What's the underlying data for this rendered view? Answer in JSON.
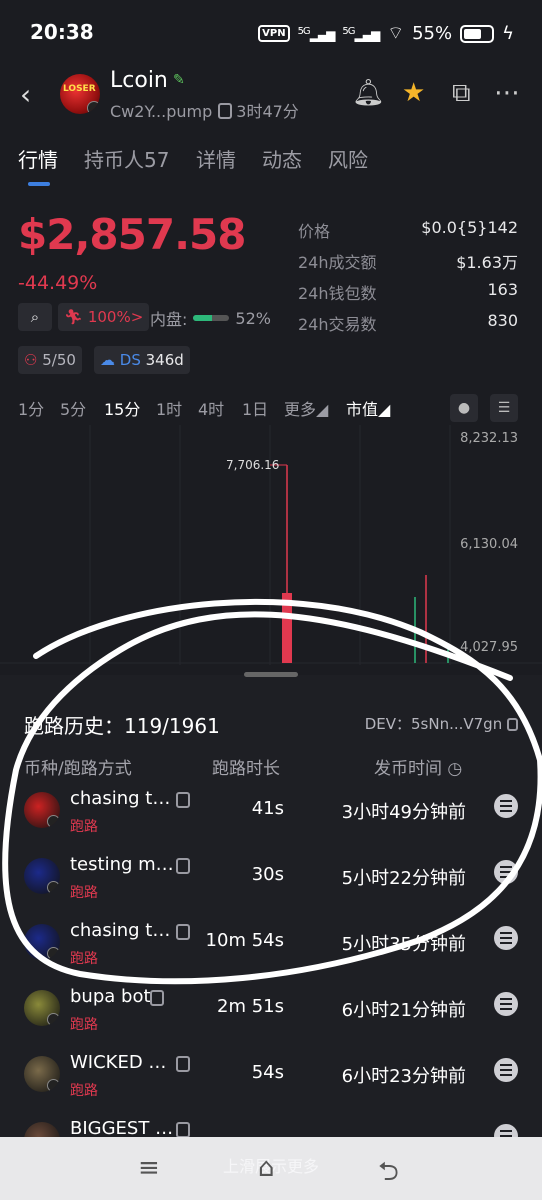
{
  "status": {
    "time": "20:38",
    "vpn": "VPN",
    "net1": "5G",
    "net2": "5G",
    "battery": "55%"
  },
  "header": {
    "title": "Lcoin",
    "address": "Cw2Y...pump",
    "age": "3时47分",
    "logo_text": "LOSER"
  },
  "tabs": [
    "行情",
    "持币人57",
    "详情",
    "动态",
    "风险"
  ],
  "price": {
    "value": "$2,857.58",
    "change": "-44.49%"
  },
  "stats": [
    {
      "k": "价格",
      "v": "$0.0{5}142"
    },
    {
      "k": "24h成交额",
      "v": "$1.63万"
    },
    {
      "k": "24h钱包数",
      "v": "163"
    },
    {
      "k": "24h交易数",
      "v": "830"
    }
  ],
  "chips": {
    "runner": "100%>",
    "inner_label": "内盘:",
    "inner_pct": "52%",
    "inner_value": 0.52,
    "holders": "5/50",
    "ds_label": "DS",
    "ds_days": "346d"
  },
  "timeframes": [
    "1分",
    "5分",
    "15分",
    "1时",
    "4时",
    "1日",
    "更多◢",
    "市值◢"
  ],
  "chart": {
    "y_top": "8,232.13",
    "y_mid": "6,130.04",
    "y_low": "4,027.95",
    "peak_label": "7,706.16"
  },
  "rug": {
    "title": "跑路历史：119/1961",
    "dev": "DEV：5sNn...V7gn",
    "cols": [
      "币种/跑路方式",
      "跑路时长",
      "发币时间"
    ],
    "rows": [
      {
        "name": "chasing t…",
        "tag": "跑路",
        "dur": "41s",
        "time": "3小时49分钟前",
        "color": "#c22"
      },
      {
        "name": "testing m…",
        "tag": "跑路",
        "dur": "30s",
        "time": "5小时22分钟前",
        "color": "#1c2a8a"
      },
      {
        "name": "chasing t…",
        "tag": "跑路",
        "dur": "10m 54s",
        "time": "5小时35分钟前",
        "color": "#1c2a8a"
      },
      {
        "name": "bupa bot",
        "tag": "跑路",
        "dur": "2m 51s",
        "time": "6小时21分钟前",
        "color": "#8a8a3a"
      },
      {
        "name": "WICKED …",
        "tag": "跑路",
        "dur": "54s",
        "time": "6小时23分钟前",
        "color": "#7a6a4a"
      },
      {
        "name": "BIGGEST …",
        "tag": "",
        "dur": "",
        "time": "",
        "color": "#6a4a3a"
      }
    ]
  },
  "nav": {
    "hint": "上滑展示更多"
  }
}
